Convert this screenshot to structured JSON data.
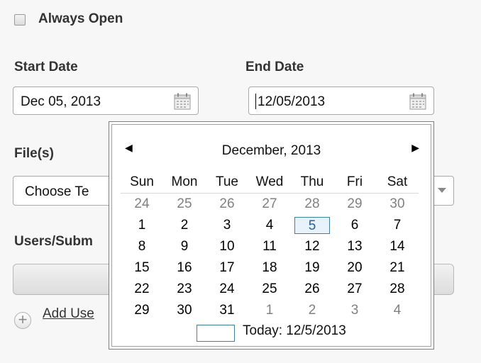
{
  "always_open": {
    "label": "Always Open",
    "checked": false
  },
  "start_date": {
    "label": "Start Date",
    "value": "Dec 05, 2013"
  },
  "end_date": {
    "label": "End Date",
    "value": "12/05/2013"
  },
  "files": {
    "label": "File(s)",
    "select_value": "Choose Te"
  },
  "users": {
    "label": "Users/Subm"
  },
  "add_user": {
    "label": "Add Use"
  },
  "calendar": {
    "month_label": "December, 2013",
    "prev_icon": "◀",
    "next_icon": "▶",
    "weekdays": [
      "Sun",
      "Mon",
      "Tue",
      "Wed",
      "Thu",
      "Fri",
      "Sat"
    ],
    "weeks": [
      [
        "24",
        "25",
        "26",
        "27",
        "28",
        "29",
        "30"
      ],
      [
        "1",
        "2",
        "3",
        "4",
        "5",
        "6",
        "7"
      ],
      [
        "8",
        "9",
        "10",
        "11",
        "12",
        "13",
        "14"
      ],
      [
        "15",
        "16",
        "17",
        "18",
        "19",
        "20",
        "21"
      ],
      [
        "22",
        "23",
        "24",
        "25",
        "26",
        "27",
        "28"
      ],
      [
        "29",
        "30",
        "31",
        "1",
        "2",
        "3",
        "4"
      ]
    ],
    "selected": "5",
    "today_label": "Today: 12/5/2013"
  }
}
